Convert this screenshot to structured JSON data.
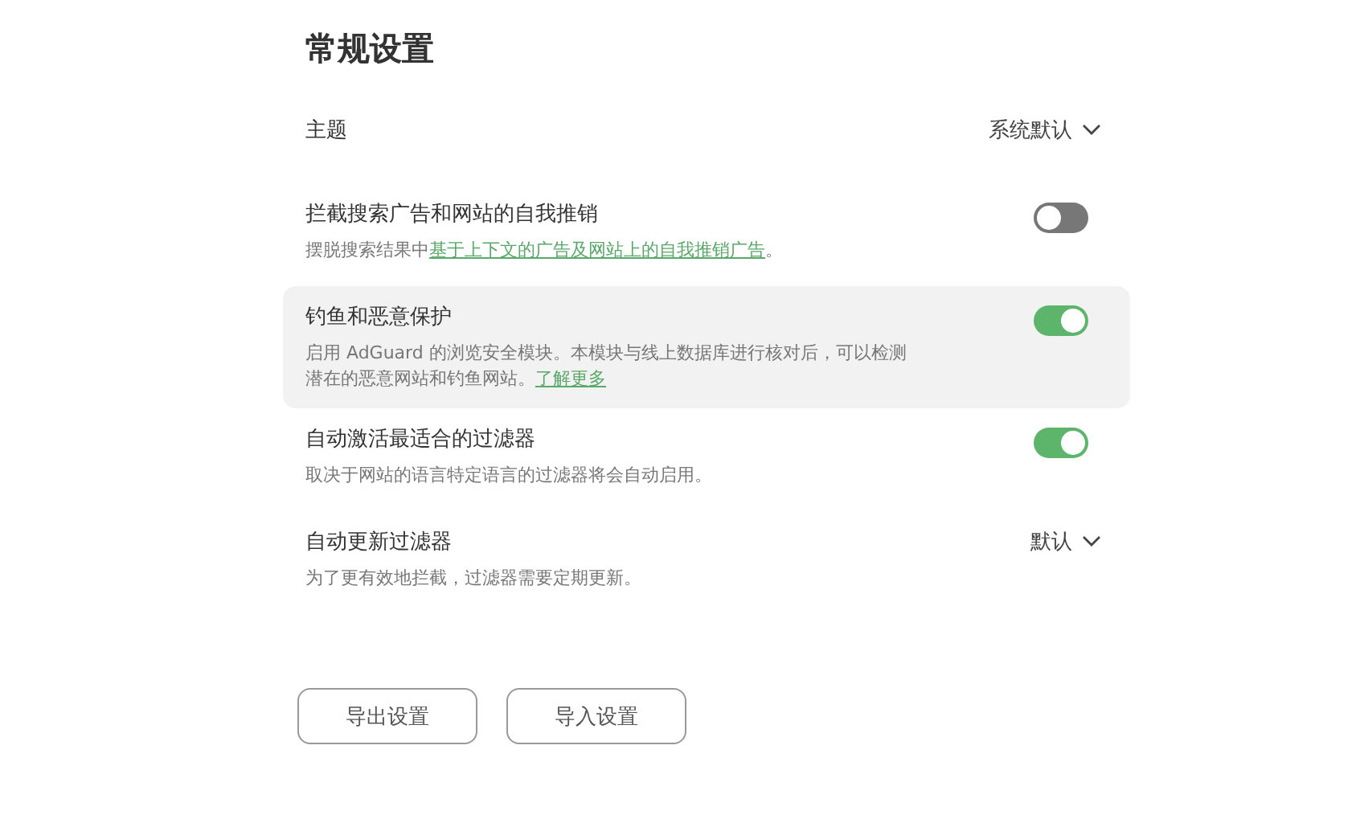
{
  "title": "常规设置",
  "settings": [
    {
      "kind": "select",
      "label": "主题",
      "value": "系统默认",
      "highlighted": false
    },
    {
      "kind": "toggle",
      "label": "拦截搜索广告和网站的自我推销",
      "description": {
        "text": "摆脱搜索结果中",
        "link": "基于上下文的广告及网站上的自我推销广告",
        "after": "。"
      },
      "on": false,
      "highlighted": false
    },
    {
      "kind": "toggle",
      "label": "钓鱼和恶意保护",
      "description": {
        "text": "启用 AdGuard 的浏览安全模块。本模块与线上数据库进行核对后，可以检测潜在的恶意网站和钓鱼网站。",
        "link": "了解更多"
      },
      "on": true,
      "highlighted": true
    },
    {
      "kind": "toggle",
      "label": "自动激活最适合的过滤器",
      "description": {
        "text": "取决于网站的语言特定语言的过滤器将会自动启用。"
      },
      "on": true,
      "highlighted": false
    },
    {
      "kind": "select",
      "label": "自动更新过滤器",
      "description": {
        "text": "为了更有效地拦截，过滤器需要定期更新。"
      },
      "value": "默认",
      "highlighted": false
    }
  ],
  "buttons": [
    "导出设置",
    "导入设置"
  ]
}
